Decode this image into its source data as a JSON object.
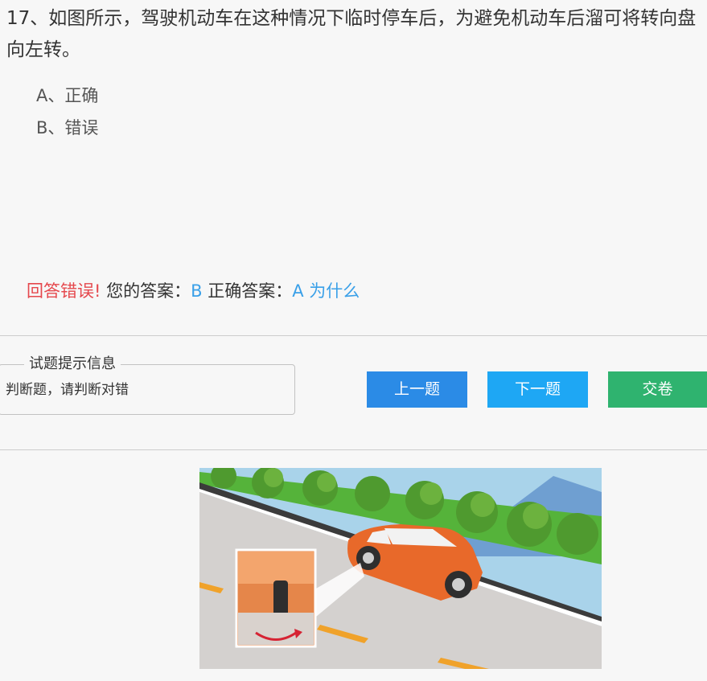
{
  "question": {
    "number": "17、",
    "text": "如图所示，驾驶机动车在这种情况下临时停车后，为避免机动车后溜可将转向盘向左转。"
  },
  "options": [
    {
      "key": "A、",
      "text": "正确"
    },
    {
      "key": "B、",
      "text": "错误"
    }
  ],
  "result": {
    "status": "回答错误!",
    "your_answer_label": "您的答案：",
    "your_answer": "B",
    "correct_answer_label": "正确答案：",
    "correct_answer": "A",
    "why_link": "为什么"
  },
  "hint": {
    "legend": "试题提示信息",
    "text": "判断题，请判断对错"
  },
  "buttons": {
    "prev": "上一题",
    "next": "下一题",
    "submit": "交卷"
  },
  "colors": {
    "error": "#e5484d",
    "answer": "#3aa0e8",
    "prev_button": "#2b8be6",
    "next_button": "#1ea7f4",
    "submit_button": "#2fb36f"
  },
  "image": {
    "subject": "orange car parked on uphill road shoulder with front wheel turned toward curb"
  }
}
